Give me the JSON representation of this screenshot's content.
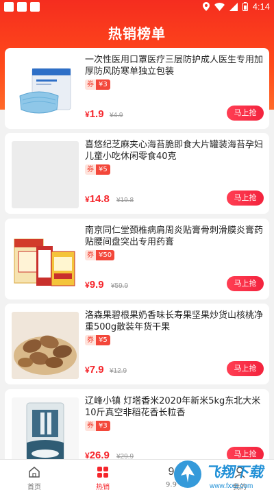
{
  "statusbar": {
    "time": "4:14"
  },
  "page": {
    "title": "热销榜单"
  },
  "products": [
    {
      "title": "一次性医用口罩医疗三层防护成人医生专用加厚防风防寒单独立包装",
      "coupon_prefix": "券",
      "coupon": "¥3",
      "currency": "¥",
      "price": "1.9",
      "original_price": "¥4.9",
      "buy_label": "马上抢",
      "image_icon": "mask-box-image"
    },
    {
      "title": "喜悠纪芝麻夹心海苔脆即食大片罐装海苔孕妇儿童小吃休闲零食40克",
      "coupon_prefix": "券",
      "coupon": "¥5",
      "currency": "¥",
      "price": "14.8",
      "original_price": "¥19.8",
      "buy_label": "马上抢",
      "image_icon": "placeholder-image"
    },
    {
      "title": "南京同仁堂颈椎病肩周炎贴膏骨刺滑膜炎膏药贴腰间盘突出专用药膏",
      "coupon_prefix": "券",
      "coupon": "¥50",
      "currency": "¥",
      "price": "9.9",
      "original_price": "¥59.9",
      "buy_label": "马上抢",
      "image_icon": "medicine-box-image"
    },
    {
      "title": "洛森果碧根果奶香味长寿果坚果炒货山核桃净重500g散装年货干果",
      "coupon_prefix": "券",
      "coupon": "¥5",
      "currency": "¥",
      "price": "7.9",
      "original_price": "¥12.9",
      "buy_label": "马上抢",
      "image_icon": "pecan-nuts-image"
    },
    {
      "title": "辽峰小镇 灯塔香米2020年新米5kg东北大米10斤真空非稻花香长粒香",
      "coupon_prefix": "券",
      "coupon": "¥3",
      "currency": "¥",
      "price": "26.9",
      "original_price": "¥29.9",
      "buy_label": "马上抢",
      "image_icon": "rice-bag-image"
    }
  ],
  "tabbar": {
    "tabs": [
      {
        "label": "首页",
        "icon": "home-icon"
      },
      {
        "label": "热销",
        "icon": "hot-grid-icon"
      },
      {
        "label": "9.9",
        "icon": "nine-nine-icon"
      },
      {
        "label": "我的",
        "icon": "profile-icon"
      }
    ],
    "nine_glyph": "9"
  },
  "watermark": {
    "text": "飞翔下载",
    "url": "www.fxxz.com"
  },
  "colors": {
    "header_red": "#f52d1f",
    "price_red": "#f5262c",
    "coupon_red": "#f3473a"
  }
}
